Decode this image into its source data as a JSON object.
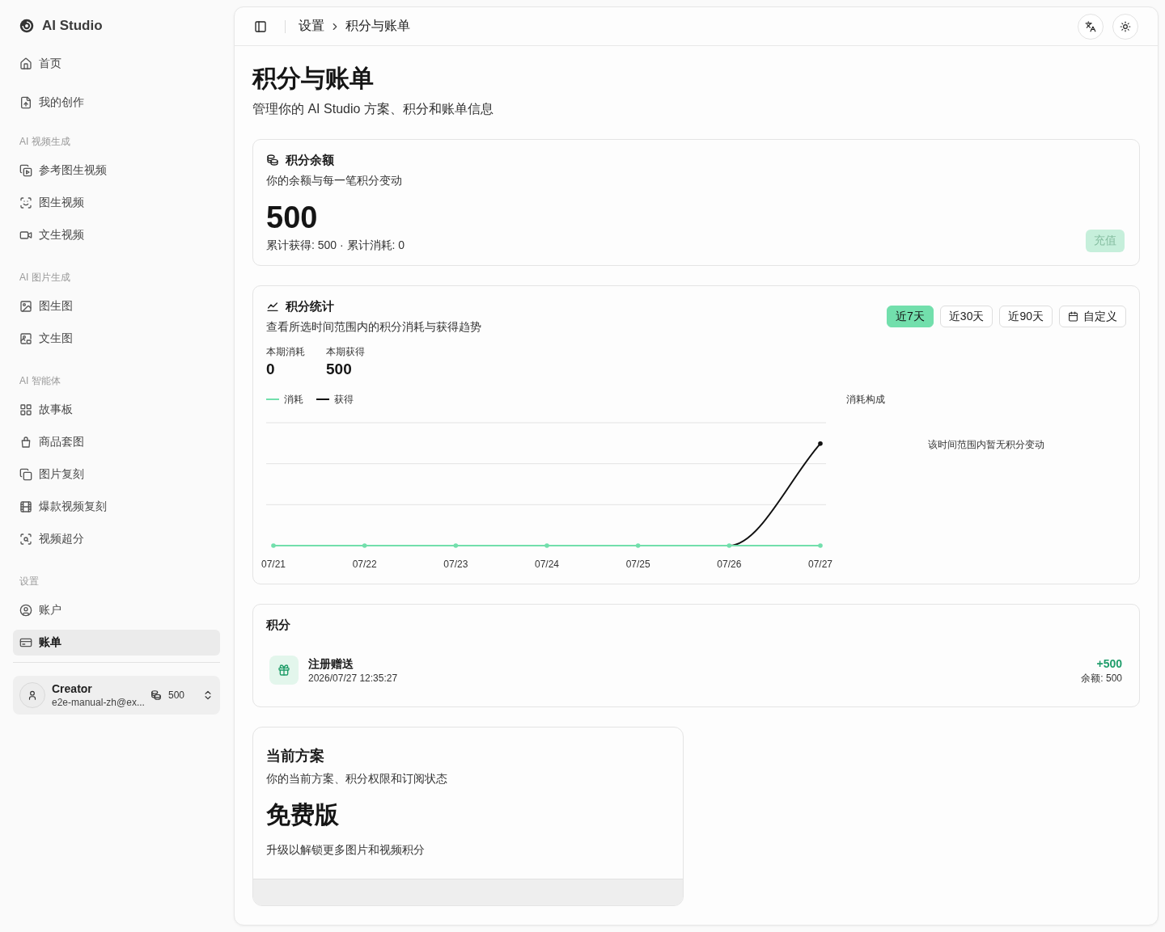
{
  "sidebar": {
    "brand": "AI Studio",
    "sections": [
      {
        "items": [
          {
            "label": "首页",
            "selected": false
          },
          {
            "label": "我的创作",
            "selected": false
          }
        ]
      },
      {
        "heading": "AI 视频生成",
        "items": [
          {
            "label": "参考图生视频",
            "selected": false
          },
          {
            "label": "图生视频",
            "selected": false
          },
          {
            "label": "文生视频",
            "selected": false
          }
        ]
      },
      {
        "heading": "AI 图片生成",
        "items": [
          {
            "label": "图生图",
            "selected": false
          },
          {
            "label": "文生图",
            "selected": false
          }
        ]
      },
      {
        "heading": "AI 智能体",
        "items": [
          {
            "label": "故事板",
            "selected": false
          },
          {
            "label": "商品套图",
            "selected": false
          },
          {
            "label": "图片复刻",
            "selected": false
          },
          {
            "label": "爆款视频复刻",
            "selected": false
          },
          {
            "label": "视频超分",
            "selected": false
          }
        ]
      },
      {
        "heading": "设置",
        "items": [
          {
            "label": "账户",
            "selected": false
          },
          {
            "label": "账单",
            "selected": true
          }
        ]
      }
    ],
    "user": {
      "name": "Creator",
      "email": "e2e-manual-zh@ex...",
      "credits": "500"
    }
  },
  "header": {
    "breadcrumb": [
      "设置",
      "积分与账单"
    ]
  },
  "page": {
    "title": "积分与账单",
    "subtitle": "管理你的 AI Studio 方案、积分和账单信息"
  },
  "balance_card": {
    "title": "积分余额",
    "description": "你的余额与每一笔积分变动",
    "balance": "500",
    "totals": "累计获得: 500 · 累计消耗: 0",
    "recharge_button": {
      "label": "充值",
      "disabled": true
    }
  },
  "stats_card": {
    "title": "积分统计",
    "description": "查看所选时间范围内的积分消耗与获得趋势",
    "ranges": [
      {
        "label": "近7天",
        "kind": "preset",
        "selected": true
      },
      {
        "label": "近30天",
        "kind": "preset",
        "selected": false
      },
      {
        "label": "近90天",
        "kind": "preset",
        "selected": false
      },
      {
        "label": "自定义",
        "kind": "custom",
        "selected": false
      }
    ],
    "summary": [
      {
        "label": "本期消耗",
        "value": "0"
      },
      {
        "label": "本期获得",
        "value": "500"
      }
    ],
    "trend_chart": {
      "series": [
        {
          "name": "消耗",
          "color": "#72dfac"
        },
        {
          "name": "获得",
          "color": "#111111"
        }
      ],
      "x_labels": [
        "07/21",
        "07/22",
        "07/23",
        "07/24",
        "07/25",
        "07/26",
        "07/27"
      ]
    },
    "breakdown": {
      "title": "消耗构成",
      "empty_text": "该时间范围内暂无积分变动"
    }
  },
  "credits_card": {
    "title": "积分",
    "transactions": [
      {
        "kind": "credit",
        "title": "注册赠送",
        "time": "2026/07/27 12:35:27",
        "amount": "+500",
        "balance": "余额: 500"
      }
    ]
  },
  "plan_card": {
    "title": "当前方案",
    "description": "你的当前方案、积分权限和订阅状态",
    "plan": "免费版",
    "note": "升级以解锁更多图片和视频积分"
  }
}
